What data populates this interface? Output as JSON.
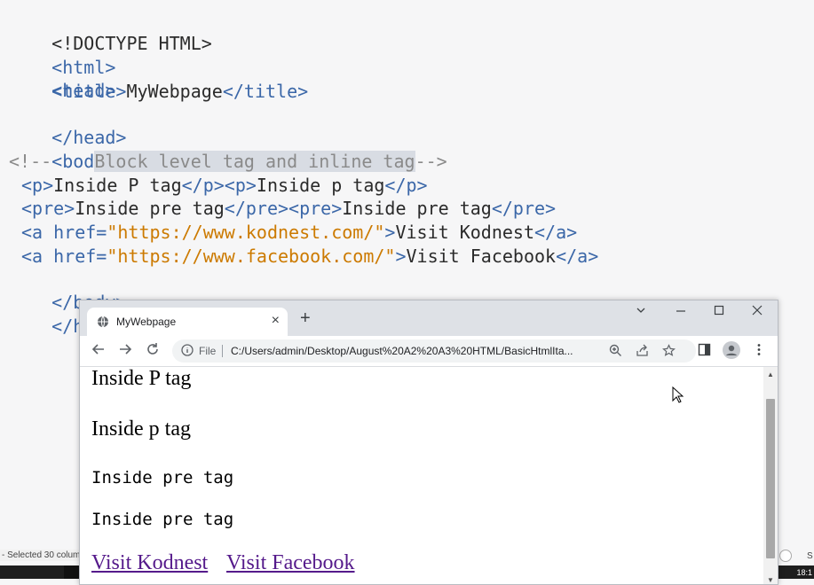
{
  "editor": {
    "lines": {
      "l1": "<!DOCTYPE HTML>",
      "l2_open": "<html>",
      "l3_open": "<head>",
      "l4_indent": "    ",
      "l4_open": "<title>",
      "l4_text": "MyWebpage",
      "l4_close": "</title>",
      "l5": "</head>",
      "l6": "<body>",
      "l7_start": "<!--    ",
      "l7_selected": "Block level tag and inline tag",
      "l7_end": "-->",
      "l8_a": "<p>",
      "l8_b": "Inside P tag",
      "l8_c": "</p>",
      "l8_d": "<p>",
      "l8_e": "Inside p tag",
      "l8_f": "</p>",
      "l9_a": "<pre>",
      "l9_b": "Inside pre tag",
      "l9_c": "</pre>",
      "l9_d": "<pre>",
      "l9_e": "Inside pre tag",
      "l9_f": "</pre>",
      "l10_a": "<a ",
      "l10_b": "href=",
      "l10_c": "\"https://www.kodnest.com/\"",
      "l10_d": ">",
      "l10_e": "Visit Kodnest",
      "l10_f": "</a>",
      "l11_a": "<a ",
      "l11_b": "href=",
      "l11_c": "\"https://www.facebook.com/\"",
      "l11_d": ">",
      "l11_e": "Visit Facebook",
      "l11_f": "</a>",
      "l12": "</body>",
      "l13": "</html>"
    },
    "status_text": "- Selected 30 colum",
    "right_status": "S",
    "clock": "18:1"
  },
  "browser": {
    "tab_title": "MyWebpage",
    "tab_close": "×",
    "new_tab": "+",
    "file_label": "File",
    "url": "C:/Users/admin/Desktop/August%20A2%20A3%20HTML/BasicHtmlIta...",
    "page": {
      "p1": "Inside P tag",
      "p2": "Inside p tag",
      "pre1": "Inside pre tag",
      "pre2": "Inside pre tag",
      "link1": "Visit Kodnest",
      "link2": "Visit Facebook"
    },
    "icons": {
      "back": "arrow-left-icon",
      "forward": "arrow-right-icon",
      "reload": "reload-icon",
      "zoom": "zoom-icon",
      "share": "share-icon",
      "bookmark": "star-icon",
      "sidepanel": "side-panel-icon",
      "profile": "profile-icon",
      "menu": "kebab-menu-icon"
    },
    "colors": {
      "tabstrip": "#dee1e6",
      "link_visited": "#551a8b"
    }
  }
}
